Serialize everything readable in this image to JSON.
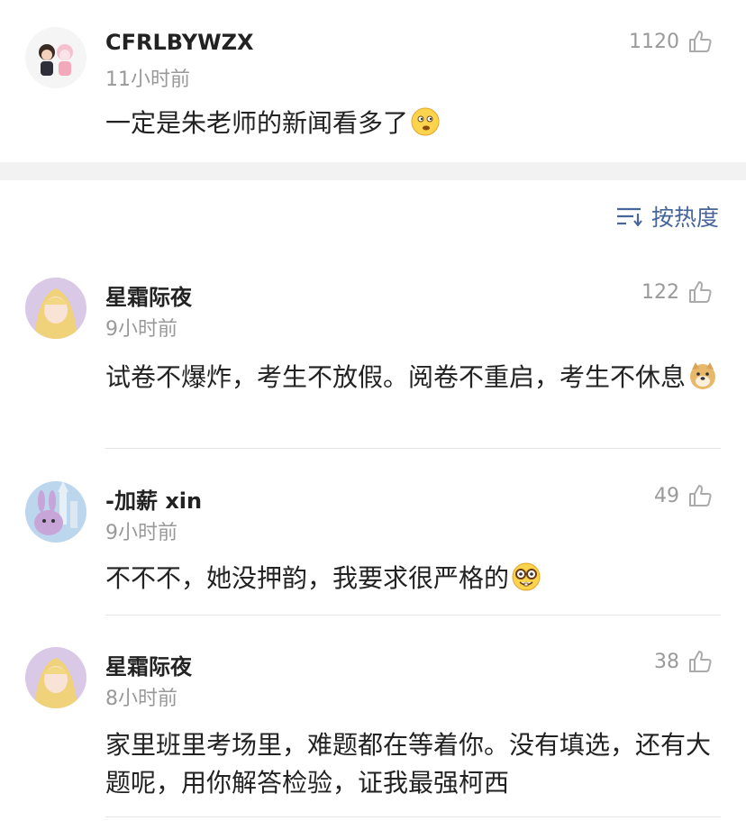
{
  "top_comment": {
    "username": "CFRLBYWZX",
    "time": "11小时前",
    "likes": "1120",
    "text": "一定是朱老师的新闻看多了",
    "emoji": "thinking-face-emoji"
  },
  "sort": {
    "label": "按热度",
    "icon": "sort-lines-icon"
  },
  "comments": [
    {
      "username": "星霜际夜",
      "time": "9小时前",
      "likes": "122",
      "text": "试卷不爆炸，考生不放假。阅卷不重启，考生不休息",
      "emoji": "doge-emoji"
    },
    {
      "username": "-加薪 xin",
      "time": "9小时前",
      "likes": "49",
      "text": "不不不，她没押韵，我要求很严格的",
      "emoji": "nerd-face-emoji"
    },
    {
      "username": "星霜际夜",
      "time": "8小时前",
      "likes": "38",
      "text": "家里班里考场里，难题都在等着你。没有填选，还有大题呢，用你解答检验，证我最强柯西",
      "emoji": ""
    }
  ],
  "colors": {
    "link_blue": "#46659b",
    "muted_gray": "#999999",
    "separator_gray": "#f2f2f2"
  }
}
